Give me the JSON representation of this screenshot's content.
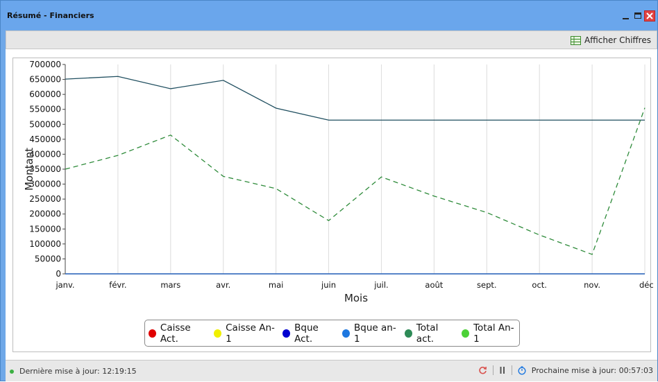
{
  "window": {
    "title": "Résumé - Financiers"
  },
  "toolbar": {
    "show_figures_label": "Afficher Chiffres",
    "show_figures_icon": "table-grid-icon"
  },
  "chart_data": {
    "type": "line",
    "xlabel": "Mois",
    "ylabel": "Montant",
    "categories": [
      "janv.",
      "févr.",
      "mars",
      "avr.",
      "mai",
      "juin",
      "juil.",
      "août",
      "sept.",
      "oct.",
      "nov.",
      "déc"
    ],
    "ylim": [
      0,
      700000
    ],
    "yticks": [
      0,
      50000,
      100000,
      150000,
      200000,
      250000,
      300000,
      350000,
      400000,
      450000,
      500000,
      550000,
      600000,
      650000,
      700000
    ],
    "grid": "vertical",
    "legend_position": "bottom",
    "series": [
      {
        "name": "Caisse Act.",
        "color": "#e00000",
        "style": "solid",
        "values": [
          0,
          0,
          0,
          0,
          0,
          0,
          0,
          0,
          0,
          0,
          0,
          0
        ]
      },
      {
        "name": "Caisse An-1",
        "color": "#f0f000",
        "style": "solid",
        "values": [
          0,
          0,
          0,
          0,
          0,
          0,
          0,
          0,
          0,
          0,
          0,
          0
        ]
      },
      {
        "name": "Bque Act.",
        "color": "#0000d0",
        "style": "solid",
        "values": [
          0,
          0,
          0,
          0,
          0,
          0,
          0,
          0,
          0,
          0,
          0,
          0
        ]
      },
      {
        "name": "Bque an-1",
        "color": "#1e78e0",
        "style": "solid",
        "values": [
          0,
          0,
          0,
          0,
          0,
          0,
          0,
          0,
          0,
          0,
          0,
          0
        ]
      },
      {
        "name": "Total act.",
        "color": "#2e8b57",
        "style": "solid",
        "line_color": "#1f4e5f",
        "values": [
          651000,
          660000,
          619000,
          647000,
          554000,
          514000,
          514000,
          514000,
          514000,
          514000,
          514000,
          514000
        ]
      },
      {
        "name": "Total An-1",
        "color": "#4cd137",
        "style": "dashed",
        "line_color": "#2e8b3a",
        "values": [
          350000,
          396000,
          464000,
          326000,
          285000,
          178000,
          324000,
          260000,
          205000,
          130000,
          65000,
          555000
        ]
      }
    ]
  },
  "statusbar": {
    "last_update_label": "Dernière mise à jour: 12:19:15",
    "next_update_label": "Prochaine mise à jour: 00:57:03"
  }
}
